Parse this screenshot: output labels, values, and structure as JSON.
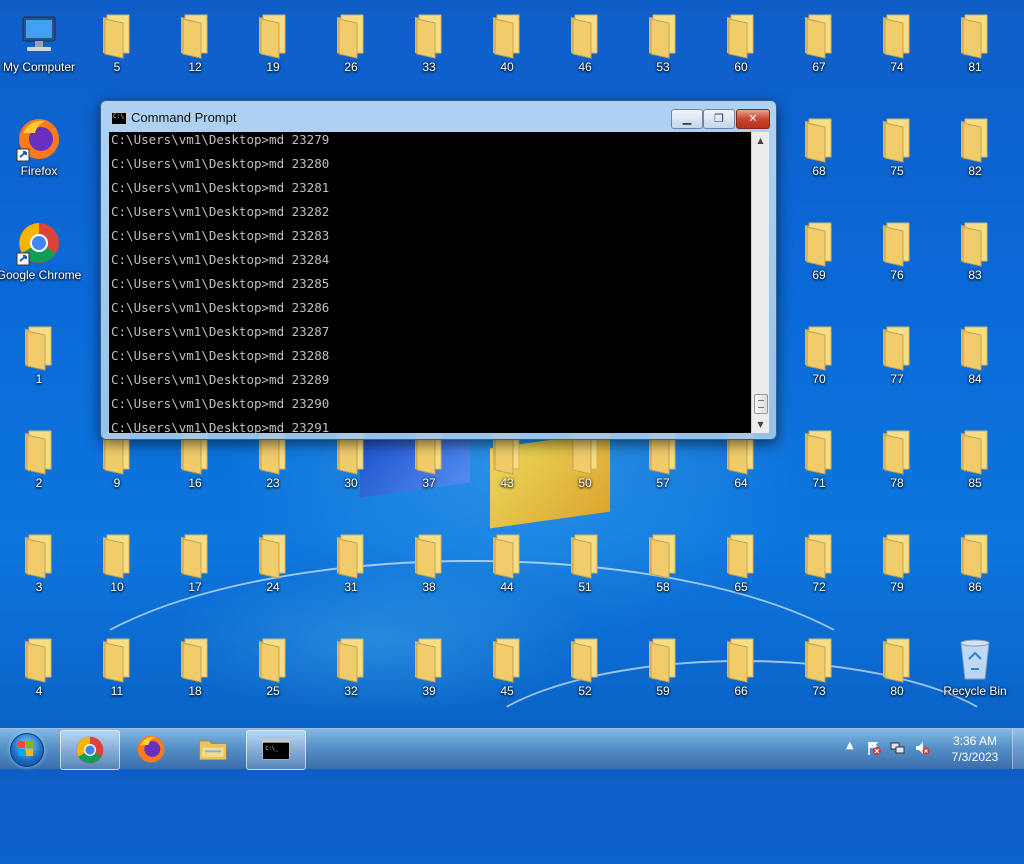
{
  "desktop": {
    "special_icons": {
      "my_computer": "My Computer",
      "firefox": "Firefox",
      "chrome": "Google Chrome",
      "recycle_bin": "Recycle Bin"
    },
    "folders": [
      "1",
      "2",
      "3",
      "4",
      "5",
      "9",
      "10",
      "11",
      "12",
      "16",
      "17",
      "18",
      "19",
      "23",
      "24",
      "25",
      "26",
      "30",
      "31",
      "32",
      "33",
      "37",
      "38",
      "39",
      "40",
      "43",
      "44",
      "45",
      "46",
      "50",
      "51",
      "52",
      "53",
      "57",
      "58",
      "59",
      "60",
      "64",
      "65",
      "66",
      "67",
      "68",
      "69",
      "70",
      "71",
      "72",
      "73",
      "74",
      "75",
      "76",
      "77",
      "78",
      "79",
      "80",
      "81",
      "82",
      "83",
      "84",
      "85",
      "86"
    ]
  },
  "window": {
    "title": "Command Prompt",
    "lines": [
      "C:\\Users\\vm1\\Desktop>md 23279",
      "C:\\Users\\vm1\\Desktop>md 23280",
      "C:\\Users\\vm1\\Desktop>md 23281",
      "C:\\Users\\vm1\\Desktop>md 23282",
      "C:\\Users\\vm1\\Desktop>md 23283",
      "C:\\Users\\vm1\\Desktop>md 23284",
      "C:\\Users\\vm1\\Desktop>md 23285",
      "C:\\Users\\vm1\\Desktop>md 23286",
      "C:\\Users\\vm1\\Desktop>md 23287",
      "C:\\Users\\vm1\\Desktop>md 23288",
      "C:\\Users\\vm1\\Desktop>md 23289",
      "C:\\Users\\vm1\\Desktop>md 23290",
      "C:\\Users\\vm1\\Desktop>md 23291"
    ]
  },
  "taskbar": {
    "pinned": [
      "chrome-icon",
      "firefox-icon",
      "file-explorer-icon",
      "command-prompt-icon"
    ],
    "tray": {
      "time": "3:36 AM",
      "date": "7/3/2023"
    }
  },
  "colors": {
    "folder": "#f5d77a",
    "console_bg": "#000000",
    "console_text": "#c0c0c0"
  }
}
